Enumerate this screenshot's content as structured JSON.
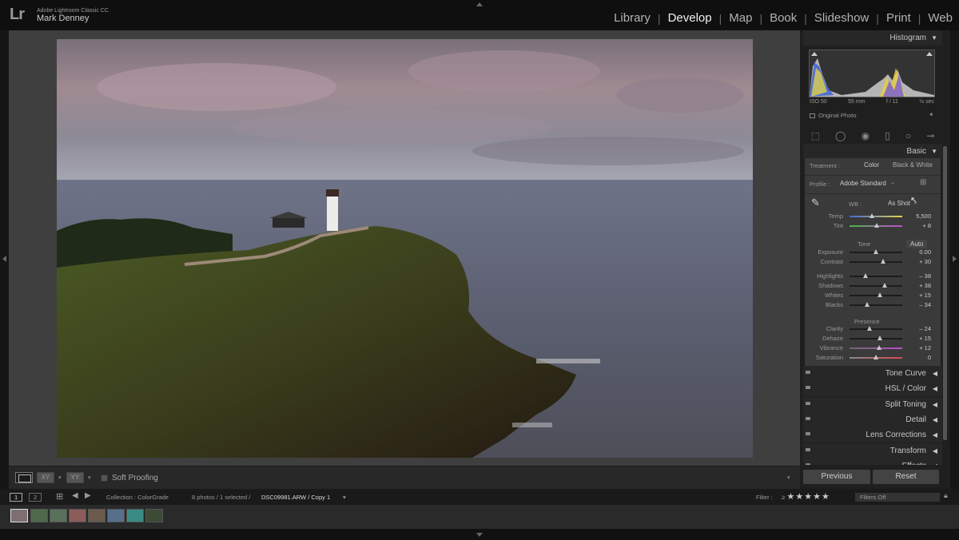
{
  "app": {
    "logo": "Lr",
    "name": "Adobe Lightroom Classic CC",
    "user": "Mark Denney"
  },
  "modules": [
    "Library",
    "Develop",
    "Map",
    "Book",
    "Slideshow",
    "Print",
    "Web"
  ],
  "active_module": "Develop",
  "toolbar": {
    "soft_proofing": "Soft Proofing",
    "compare_icon": "XY",
    "survey_icon": "YY"
  },
  "histogram": {
    "title": "Histogram",
    "iso": "ISO 50",
    "focal": "55 mm",
    "aperture": "f / 11",
    "shutter": "⅛ sec",
    "original": "Original Photo"
  },
  "basic": {
    "title": "Basic",
    "treatment_label": "Treatment :",
    "treatment_color": "Color",
    "treatment_bw": "Black & White",
    "profile_label": "Profile :",
    "profile_value": "Adobe Standard",
    "wb_label": "WB :",
    "wb_value": "As Shot",
    "tone_label": "Tone",
    "auto_label": "Auto",
    "presence_label": "Presence",
    "sliders": [
      {
        "name": "Temp",
        "value": "5,500",
        "pos": 0.42
      },
      {
        "name": "Tint",
        "value": "+ 8",
        "pos": 0.52
      },
      {
        "name": "Exposure",
        "value": "0.00",
        "pos": 0.5
      },
      {
        "name": "Contrast",
        "value": "+ 30",
        "pos": 0.63
      },
      {
        "name": "Highlights",
        "value": "– 38",
        "pos": 0.31
      },
      {
        "name": "Shadows",
        "value": "+ 38",
        "pos": 0.67
      },
      {
        "name": "Whites",
        "value": "+ 15",
        "pos": 0.57
      },
      {
        "name": "Blacks",
        "value": "– 34",
        "pos": 0.33
      },
      {
        "name": "Clarity",
        "value": "– 24",
        "pos": 0.38
      },
      {
        "name": "Dehaze",
        "value": "+ 15",
        "pos": 0.57
      },
      {
        "name": "Vibrance",
        "value": "+ 12",
        "pos": 0.56
      },
      {
        "name": "Saturation",
        "value": "0",
        "pos": 0.5
      }
    ]
  },
  "panels": [
    "Tone Curve",
    "HSL / Color",
    "Split Toning",
    "Detail",
    "Lens Corrections",
    "Transform",
    "Effects"
  ],
  "buttons": {
    "previous": "Previous",
    "reset": "Reset"
  },
  "filmstrip_bar": {
    "screen1": "1",
    "screen2": "2",
    "collection": "Collection : ColorGrade",
    "count": "8 photos / 1 selected /",
    "filename": "DSC09981.ARW / Copy 1",
    "filter_label": "Filter :",
    "filter_value": "Filters Off"
  }
}
